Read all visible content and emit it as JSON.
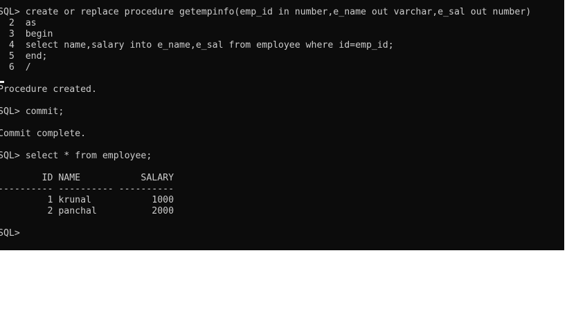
{
  "console": {
    "lines": [
      "SQL> create or replace procedure getempinfo(emp_id in number,e_name out varchar,e_sal out number)",
      "  2  as",
      "  3  begin",
      "  4  select name,salary into e_name,e_sal from employee where id=emp_id;",
      "  5  end;",
      "  6  /",
      "",
      "Procedure created.",
      "",
      "SQL> commit;",
      "",
      "Commit complete.",
      "",
      "SQL> select * from employee;",
      "",
      "        ID NAME           SALARY",
      "---------- ---------- ----------",
      "         1 krunal           1000",
      "         2 panchal          2000",
      "",
      "SQL>"
    ]
  },
  "colors": {
    "background": "#0c0c0c",
    "text": "#cccccc"
  }
}
